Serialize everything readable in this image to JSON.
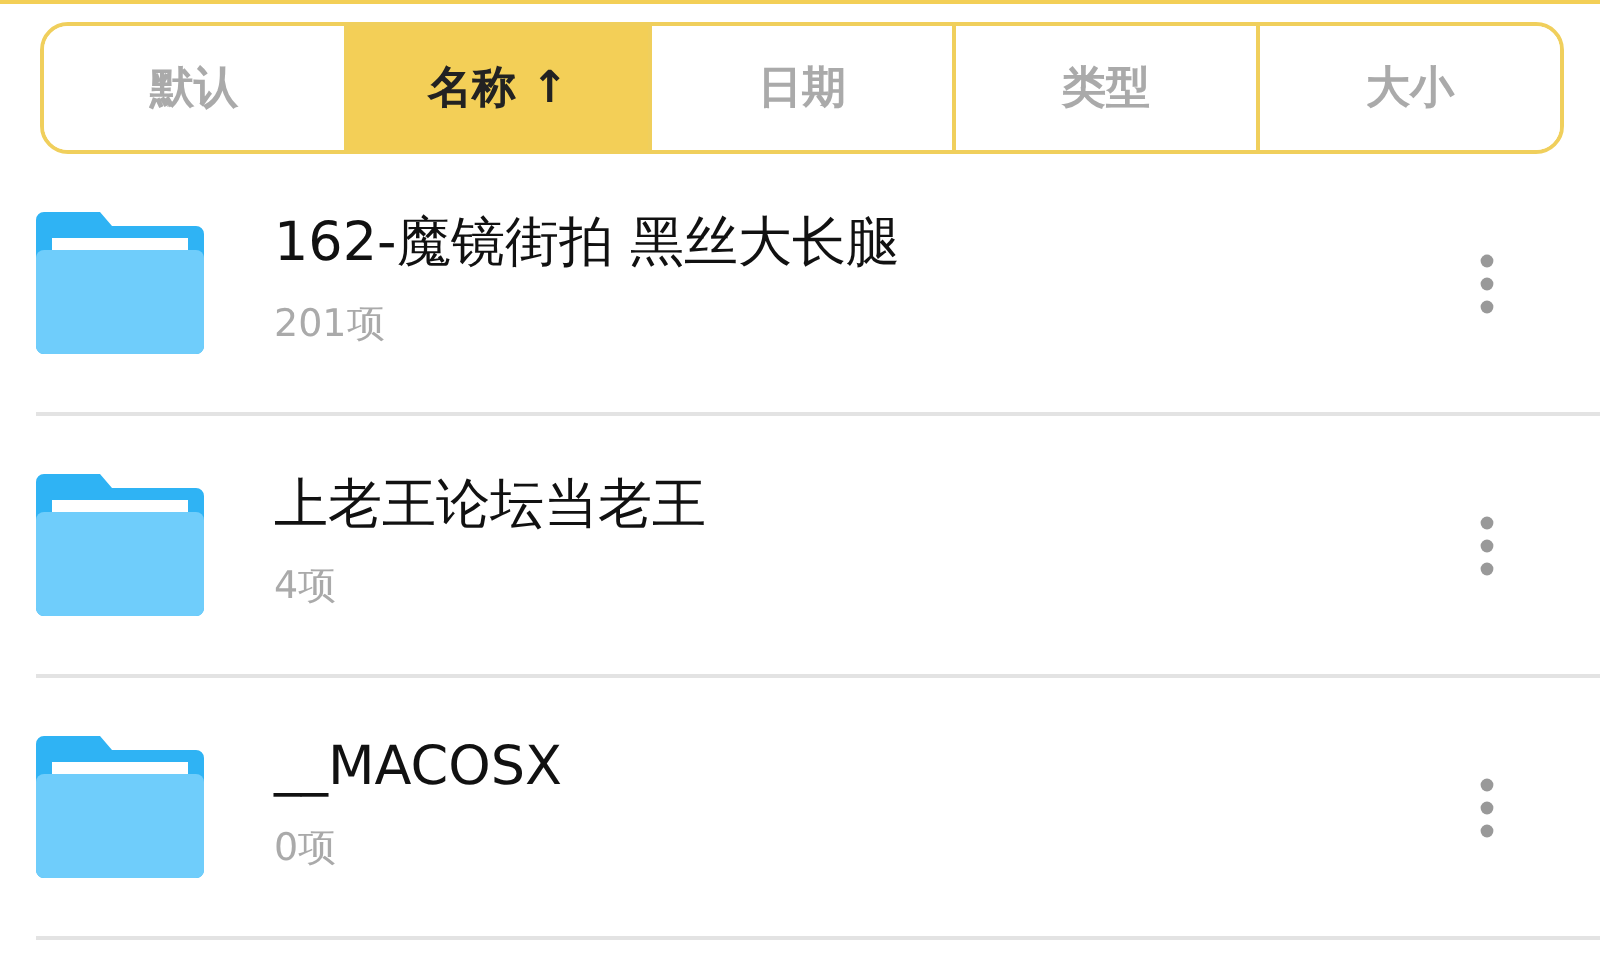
{
  "sort_tabs": [
    {
      "label": "默认",
      "selected": false
    },
    {
      "label": "名称 ↑",
      "selected": true
    },
    {
      "label": "日期",
      "selected": false
    },
    {
      "label": "类型",
      "selected": false
    },
    {
      "label": "大小",
      "selected": false
    }
  ],
  "folders": [
    {
      "name": "162-魔镜街拍 黑丝大长腿",
      "count": "201项"
    },
    {
      "name": "上老王论坛当老王",
      "count": "4项"
    },
    {
      "name": "__MACOSX",
      "count": "0项"
    }
  ]
}
